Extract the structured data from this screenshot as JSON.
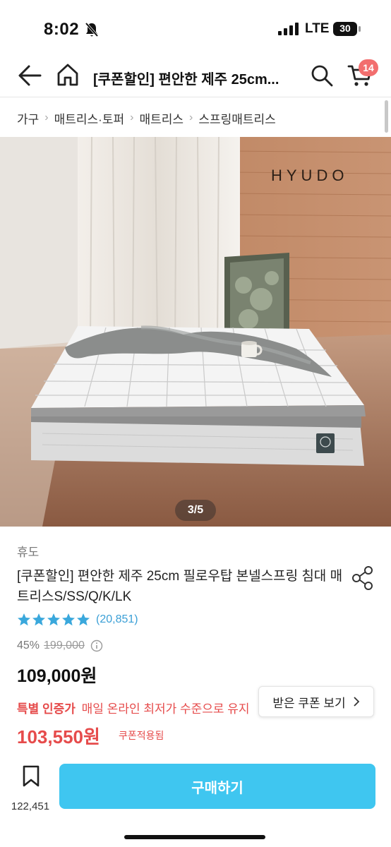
{
  "status_bar": {
    "time": "8:02",
    "network": "LTE",
    "battery": "30"
  },
  "nav": {
    "title": "[쿠폰할인] 편안한 제주 25cm...",
    "cart_count": "14"
  },
  "breadcrumb": [
    "가구",
    "매트리스·토퍼",
    "매트리스",
    "스프링매트리스"
  ],
  "image": {
    "counter": "3/5",
    "watermark": "HYUDO"
  },
  "product": {
    "brand": "휴도",
    "name": "[쿠폰할인] 편안한 제주 25cm 필로우탑 본넬스프링 침대 매트리스S/SS/Q/K/LK",
    "rating": 4.8,
    "review_count": "(20,851)",
    "discount": "45%",
    "original_price": "199,000",
    "sale_price": "109,000원",
    "special_label": "특별 인증가",
    "special_desc": "매일 온라인 최저가 수준으로 유지",
    "coupon_button": "받은 쿠폰 보기",
    "coupon_price": "103,550원",
    "coupon_applied": "쿠폰적용됨"
  },
  "bottom_bar": {
    "wish_count": "122,451",
    "buy_label": "구매하기"
  },
  "colors": {
    "accent": "#3fc6f0",
    "sale": "#e64b4b",
    "star": "#3aa8dc",
    "badge": "#f26e6e"
  }
}
